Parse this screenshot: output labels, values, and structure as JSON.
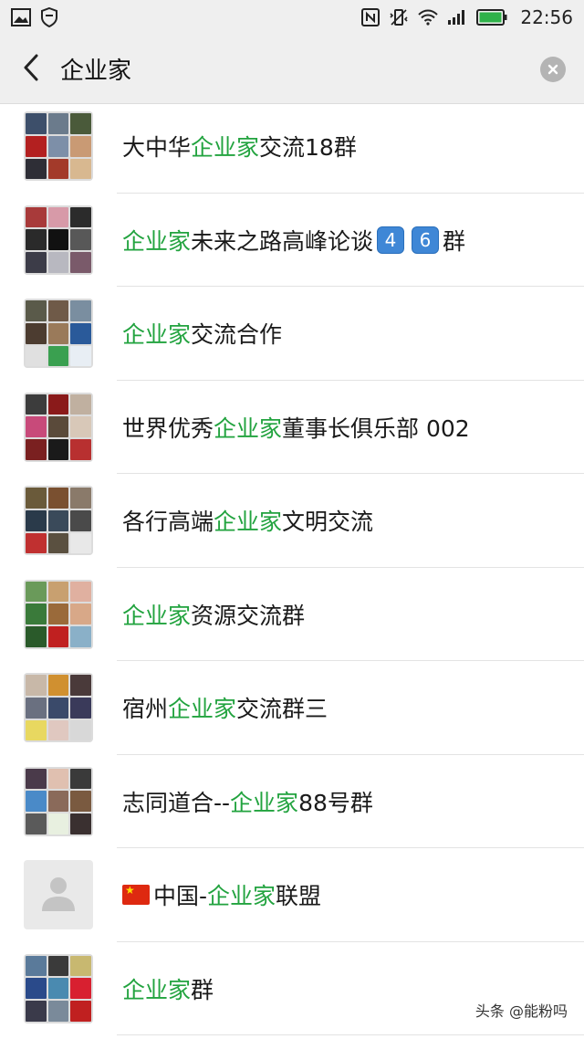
{
  "status_bar": {
    "time": "22:56",
    "left_icons": [
      "image-icon",
      "shield-icon"
    ],
    "right_icons": [
      "nfc-icon",
      "vibrate-icon",
      "wifi-icon",
      "signal-icon",
      "battery-icon"
    ]
  },
  "search": {
    "value": "企业家"
  },
  "results": [
    {
      "before": "大中华",
      "highlight": "企业家",
      "after": "交流18群"
    },
    {
      "before": "",
      "highlight": "企业家",
      "after": "未来之路高峰论谈",
      "badges": [
        "4",
        "6"
      ],
      "suffix": "群"
    },
    {
      "before": "",
      "highlight": "企业家",
      "after": "交流合作"
    },
    {
      "before": "世界优秀",
      "highlight": "企业家",
      "after": "董事长俱乐部 002"
    },
    {
      "before": "各行高端",
      "highlight": "企业家",
      "after": "文明交流"
    },
    {
      "before": "",
      "highlight": "企业家",
      "after": "资源交流群"
    },
    {
      "before": "宿州",
      "highlight": "企业家",
      "after": "交流群三"
    },
    {
      "before": "志同道合--",
      "highlight": "企业家",
      "after": "88号群"
    },
    {
      "before": "中国-",
      "highlight": "企业家",
      "after": "联盟",
      "flag": "china-flag-icon"
    },
    {
      "before": "",
      "highlight": "企业家",
      "after": "群"
    }
  ],
  "watermark": "头条 @能粉吗",
  "colors": {
    "highlight": "#22a33f",
    "header_bg": "#efefef",
    "divider": "#e3e3e3"
  }
}
